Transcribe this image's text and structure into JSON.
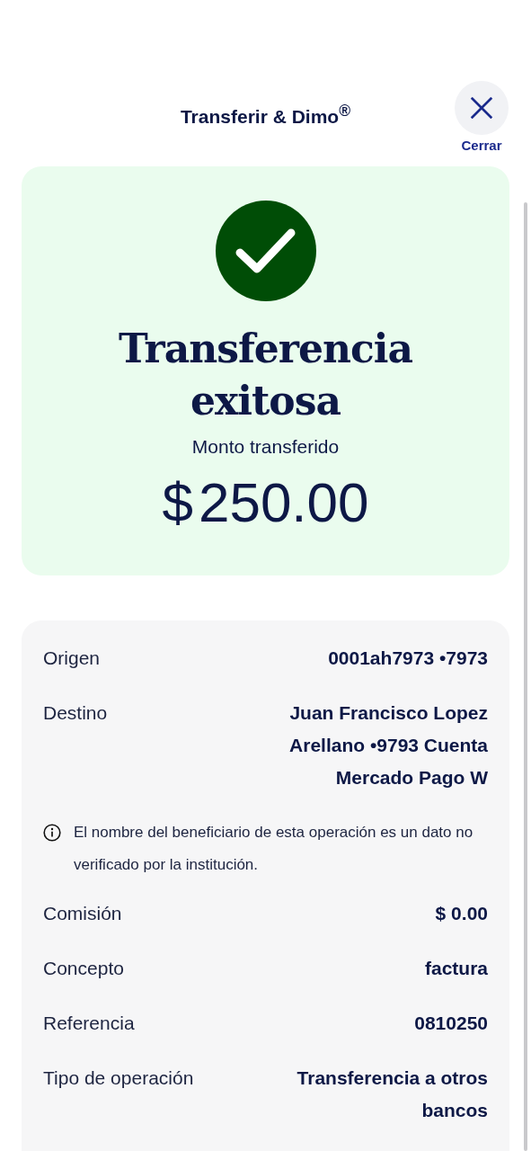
{
  "header": {
    "title": "Transferir & Dimo$^{®}$",
    "close_label": "Cerrar"
  },
  "result": {
    "title": "Transferencia exitosa",
    "amount_label": "Monto transferido",
    "amount_currency": "$",
    "amount": "250.00"
  },
  "details": [
    {
      "kind": "row",
      "label": "Origen",
      "value": "0001ah7973 •7973"
    },
    {
      "kind": "row",
      "label": "Destino",
      "value": "Juan Francisco Lopez Arellano •9793 Cuenta Mercado Pago W"
    },
    {
      "kind": "note",
      "text": "El nombre del beneficiario de esta operación es un dato no verificado por la institución."
    },
    {
      "kind": "row",
      "label": "Comisión",
      "value": "$ 0.00"
    },
    {
      "kind": "row",
      "label": "Concepto",
      "value": "factura"
    },
    {
      "kind": "row",
      "label": "Referencia",
      "value": "0810250"
    },
    {
      "kind": "row",
      "label": "Tipo de operación",
      "value": "Transferencia a otros bancos"
    }
  ]
}
